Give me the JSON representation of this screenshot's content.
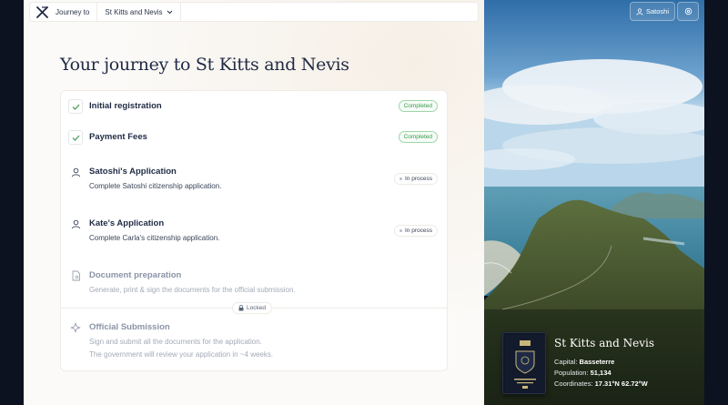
{
  "header": {
    "journey_label": "Journey to",
    "destination": "St Kitts and Nevis"
  },
  "page_title": "Your journey to St Kitts and Nevis",
  "steps": [
    {
      "title": "Initial registration",
      "desc": "",
      "status": "Completed",
      "icon": "check-icon"
    },
    {
      "title": "Payment Fees",
      "desc": "",
      "status": "Completed",
      "icon": "check-icon"
    },
    {
      "title": "Satoshi's Application",
      "desc": "Complete Satoshi citizenship application.",
      "status": "In process",
      "icon": "user-icon"
    },
    {
      "title": "Kate's Application",
      "desc": "Complete Carla's citizenship application.",
      "status": "In process",
      "icon": "user-icon"
    },
    {
      "title": "Document preparation",
      "desc": "Generate, print & sign the documents for the official submission.",
      "status": "",
      "icon": "document-icon"
    },
    {
      "title": "Official Submission",
      "desc": "Sign and submit all the documents for the application.",
      "desc2": "The government will review your application in ~4 weeks.",
      "status": "",
      "icon": "sparkle-icon"
    }
  ],
  "locked_label": "Locked",
  "user": {
    "name": "Satoshi"
  },
  "country_card": {
    "name": "St Kitts and Nevis",
    "capital_label": "Capital:",
    "capital": "Basseterre",
    "population_label": "Population:",
    "population": "51,134",
    "coordinates_label": "Coordinates:",
    "coordinates": "17.31°N 62.72°W"
  },
  "colors": {
    "accent": "#1f2a44",
    "completed": "#3a9b4e",
    "page_bg": "#fbfaf8"
  }
}
